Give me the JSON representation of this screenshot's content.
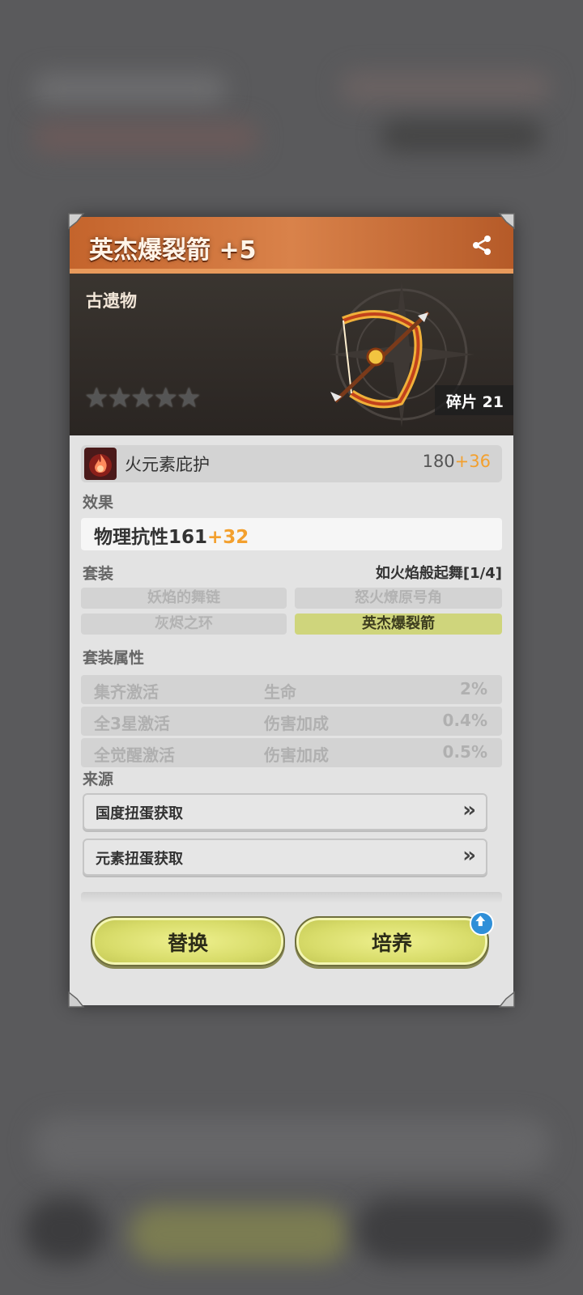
{
  "item": {
    "title": "英杰爆裂箭 +5",
    "rarity": "古遗物",
    "fragments": "碎片 21",
    "stars_total": 5,
    "stars_filled": 0
  },
  "element": {
    "name": "火元素庇护",
    "base": "180",
    "bonus": "+36"
  },
  "effect": {
    "label": "效果",
    "stat": "物理抗性161",
    "bonus": "+32"
  },
  "set": {
    "label": "套装",
    "name": "如火焰般起舞[1/4]",
    "pieces": [
      "妖焰的舞链",
      "怒火燎原号角",
      "灰烬之环",
      "英杰爆裂箭"
    ],
    "active_piece": "英杰爆裂箭"
  },
  "set_attributes": {
    "label": "套装属性",
    "rows": [
      {
        "condition": "集齐激活",
        "stat": "生命",
        "value": "2%"
      },
      {
        "condition": "全3星激活",
        "stat": "伤害加成",
        "value": "0.4%"
      },
      {
        "condition": "全觉醒激活",
        "stat": "伤害加成",
        "value": "0.5%"
      }
    ]
  },
  "source": {
    "label": "来源",
    "items": [
      "国度扭蛋获取",
      "元素扭蛋获取"
    ],
    "arrow": "»"
  },
  "buttons": {
    "replace": "替换",
    "upgrade": "培养"
  },
  "icons": {
    "share": "share-icon",
    "fire": "fire-element-icon",
    "star": "star-icon",
    "chevron": "double-chevron-right-icon",
    "upgrade_badge": "arrow-up-badge-icon"
  },
  "colors": {
    "header_orange": "#d9824a",
    "bonus_orange": "#f3a02e",
    "button_yellow": "#d8dc6a",
    "active_chip": "#cfd57c"
  }
}
